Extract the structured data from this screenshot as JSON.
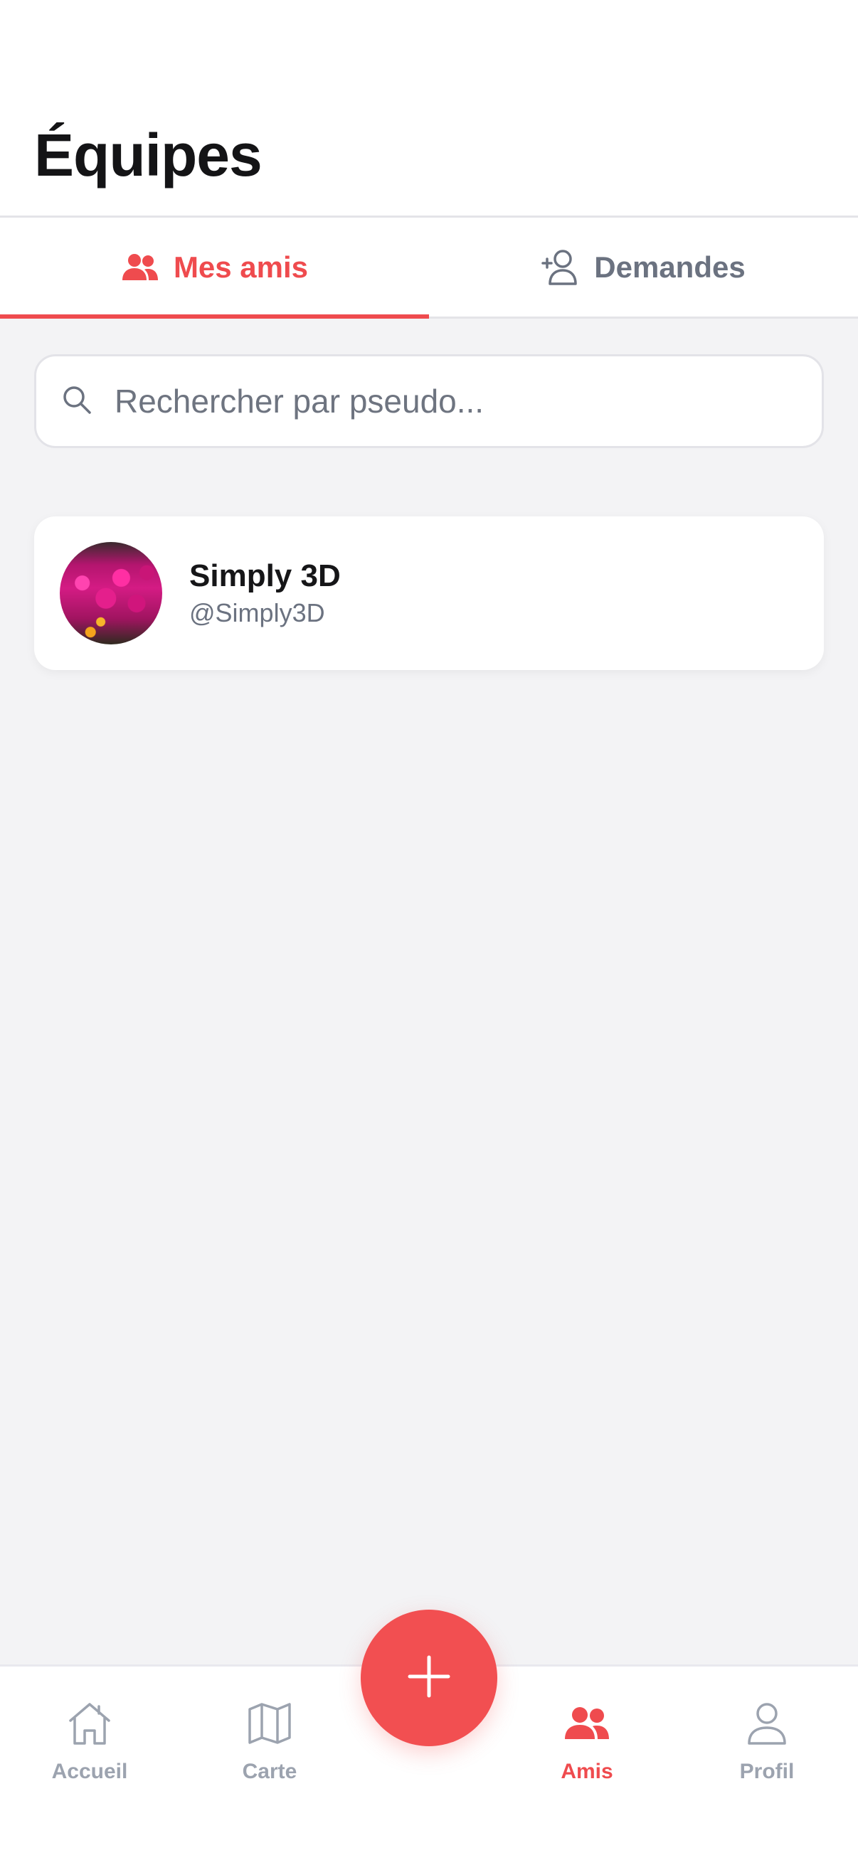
{
  "header": {
    "title": "Équipes"
  },
  "tabs": [
    {
      "label": "Mes amis",
      "icon": "users-icon",
      "active": true
    },
    {
      "label": "Demandes",
      "icon": "user-plus-icon",
      "active": false
    }
  ],
  "search": {
    "placeholder": "Rechercher par pseudo...",
    "value": "",
    "icon": "search-icon"
  },
  "friends": [
    {
      "name": "Simply 3D",
      "handle": "@Simply3D",
      "avatar": "flowers-photo"
    }
  ],
  "fab": {
    "icon": "plus-icon"
  },
  "bottom_nav": [
    {
      "label": "Accueil",
      "icon": "home-icon",
      "active": false
    },
    {
      "label": "Carte",
      "icon": "map-icon",
      "active": false
    },
    {
      "label": "Amis",
      "icon": "users-icon",
      "active": true
    },
    {
      "label": "Profil",
      "icon": "user-icon",
      "active": false
    }
  ],
  "colors": {
    "accent": "#ef4b4e",
    "inactive": "#9ca3af",
    "background": "#f3f3f5"
  }
}
